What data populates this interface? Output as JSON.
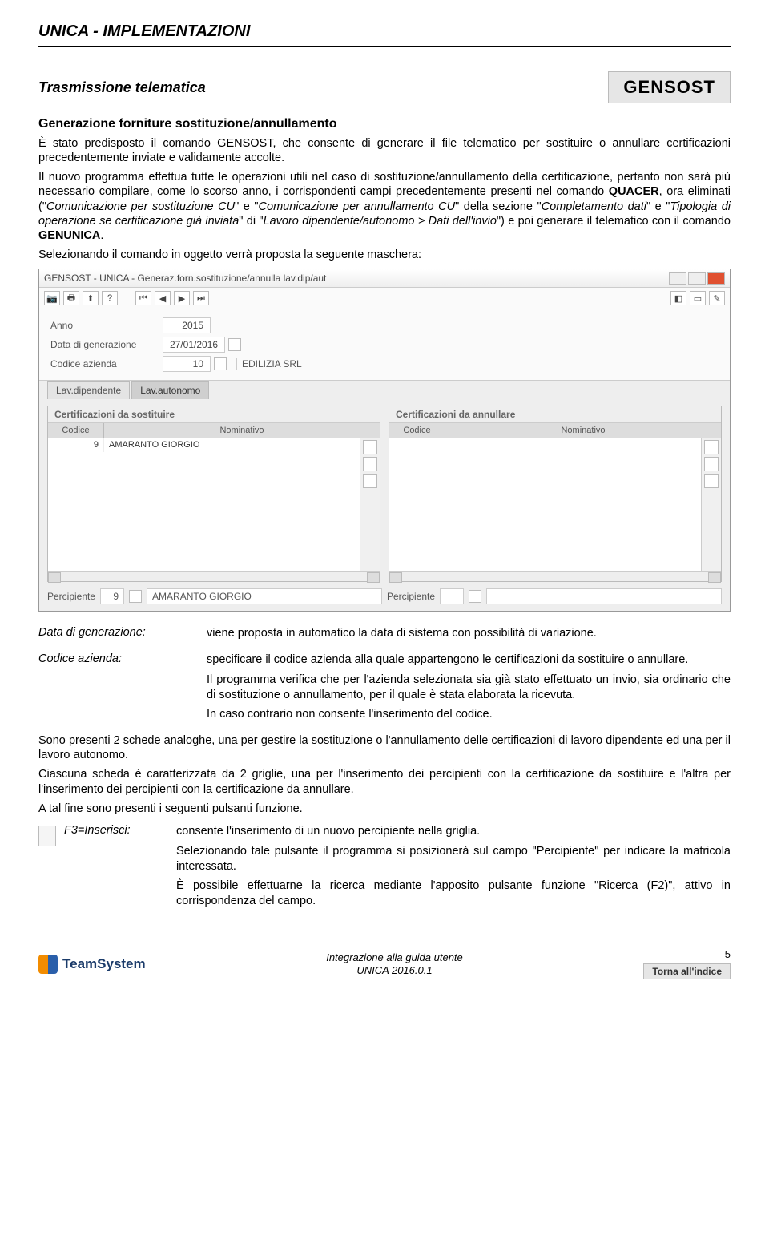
{
  "header": {
    "doc_title": "UNICA - IMPLEMENTAZIONI"
  },
  "section": {
    "title": "Trasmissione telematica",
    "badge": "GENSOST",
    "subtitle": "Generazione forniture sostituzione/annullamento"
  },
  "para": {
    "p1": "È stato predisposto il comando GENSOST, che consente di generare il file telematico per sostituire o annullare certificazioni precedentemente inviate e validamente accolte.",
    "p2a": "Il nuovo programma effettua tutte le operazioni utili nel caso di sostituzione/annullamento della certificazione, pertanto non sarà più necessario compilare, come lo scorso anno, i corrispondenti campi precedentemente presenti nel comando ",
    "p2b": "QUACER",
    "p2c": ", ora eliminati (\"",
    "p2d": "Comunicazione per sostituzione CU",
    "p2e": "\" e \"",
    "p2f": "Comunicazione per annullamento CU",
    "p2g": "\" della sezione \"",
    "p2h": "Completamento dati",
    "p2i": "\" e \"",
    "p2j": "Tipologia di operazione se certificazione già inviata",
    "p2k": "\" di \"",
    "p2l": "Lavoro dipendente/autonomo > Dati dell'invio",
    "p2m": "\") e poi generare il telematico con il comando ",
    "p2n": "GENUNICA",
    "p2o": ".",
    "p3": "Selezionando il comando in oggetto verrà proposta la seguente maschera:"
  },
  "shot": {
    "title": "GENSOST - UNICA - Generaz.forn.sostituzione/annulla lav.dip/aut",
    "form": {
      "anno_label": "Anno",
      "anno_value": "2015",
      "data_label": "Data di generazione",
      "data_value": "27/01/2016",
      "cod_label": "Codice azienda",
      "cod_value": "10",
      "cod_name": "EDILIZIA SRL"
    },
    "tabs": {
      "t1": "Lav.dipendente",
      "t2": "Lav.autonomo"
    },
    "grid1": {
      "title": "Certificazioni da sostituire",
      "col1": "Codice",
      "col2": "Nominativo",
      "row_code": "9",
      "row_name": "AMARANTO GIORGIO"
    },
    "grid2": {
      "title": "Certificazioni da annullare",
      "col1": "Codice",
      "col2": "Nominativo"
    },
    "perc": {
      "label": "Percipiente",
      "code": "9",
      "name": "AMARANTO GIORGIO"
    }
  },
  "defs": {
    "d1_label": "Data di generazione:",
    "d1_text": "viene proposta in automatico la data di sistema con possibilità di variazione.",
    "d2_label": "Codice azienda:",
    "d2_p1": "specificare il codice azienda alla quale appartengono le certificazioni da sostituire o annullare.",
    "d2_p2": "Il programma verifica che per l'azienda selezionata sia già stato effettuato un invio, sia ordinario che di sostituzione o annullamento, per il quale è stata elaborata la ricevuta.",
    "d2_p3": "In caso contrario non consente l'inserimento del codice."
  },
  "midpara": {
    "m1": "Sono presenti 2 schede analoghe, una per gestire la sostituzione o l'annullamento delle certificazioni di lavoro dipendente ed una per il lavoro autonomo.",
    "m2": "Ciascuna scheda è caratterizzata da 2 griglie, una per l'inserimento dei percipienti con la certificazione da sostituire e l'altra per l'inserimento dei percipienti con la certificazione da annullare.",
    "m3": "A tal fine sono presenti i seguenti pulsanti funzione."
  },
  "f3": {
    "label": "F3=Inserisci:",
    "p1": "consente l'inserimento di un nuovo percipiente nella griglia.",
    "p2a": "Selezionando tale pulsante il programma si posizionerà sul campo \"",
    "p2b": "Percipiente",
    "p2c": "\" per indicare la matricola interessata.",
    "p3a": "È possibile effettuarne la ricerca mediante l'apposito pulsante funzione \"",
    "p3b": "Ricerca (F2)",
    "p3c": "\", attivo in corrispondenza del campo."
  },
  "footer": {
    "brand": "TeamSystem",
    "center1": "Integrazione alla guida utente",
    "center2": "UNICA 2016.0.1",
    "page": "5",
    "back": "Torna all'indice"
  }
}
